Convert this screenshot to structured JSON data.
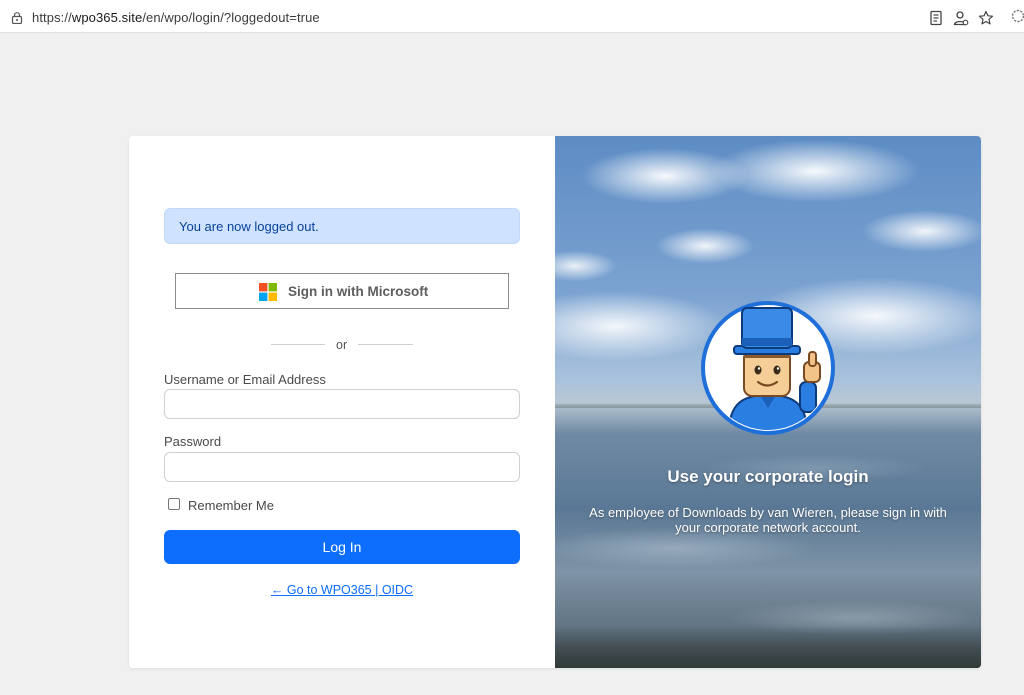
{
  "browser": {
    "url_scheme": "https://",
    "url_host": "wpo365.site",
    "url_path": "/en/wpo/login/?loggedout=true"
  },
  "login": {
    "alert_text": "You are now logged out.",
    "ms_button_label": "Sign in with Microsoft",
    "or_text": "or",
    "username_label": "Username or Email Address",
    "username_value": "",
    "password_label": "Password",
    "password_value": "",
    "remember_label": "Remember Me",
    "remember_checked": false,
    "login_button_label": "Log In",
    "back_link_text": "← Go to WPO365 | OIDC"
  },
  "corporate": {
    "headline": "Use your corporate login",
    "description": "As employee of Downloads by van Wieren, please sign in with your corporate network account."
  },
  "colors": {
    "primary": "#0d6efd",
    "alert_bg": "#cfe2ff",
    "alert_text": "#084298"
  },
  "icons": {
    "address_bar": [
      "lock-icon",
      "reader-icon",
      "person-icon",
      "star-icon",
      "extension-icon"
    ],
    "login": [
      "microsoft-logo-icon",
      "mascot-avatar"
    ]
  }
}
